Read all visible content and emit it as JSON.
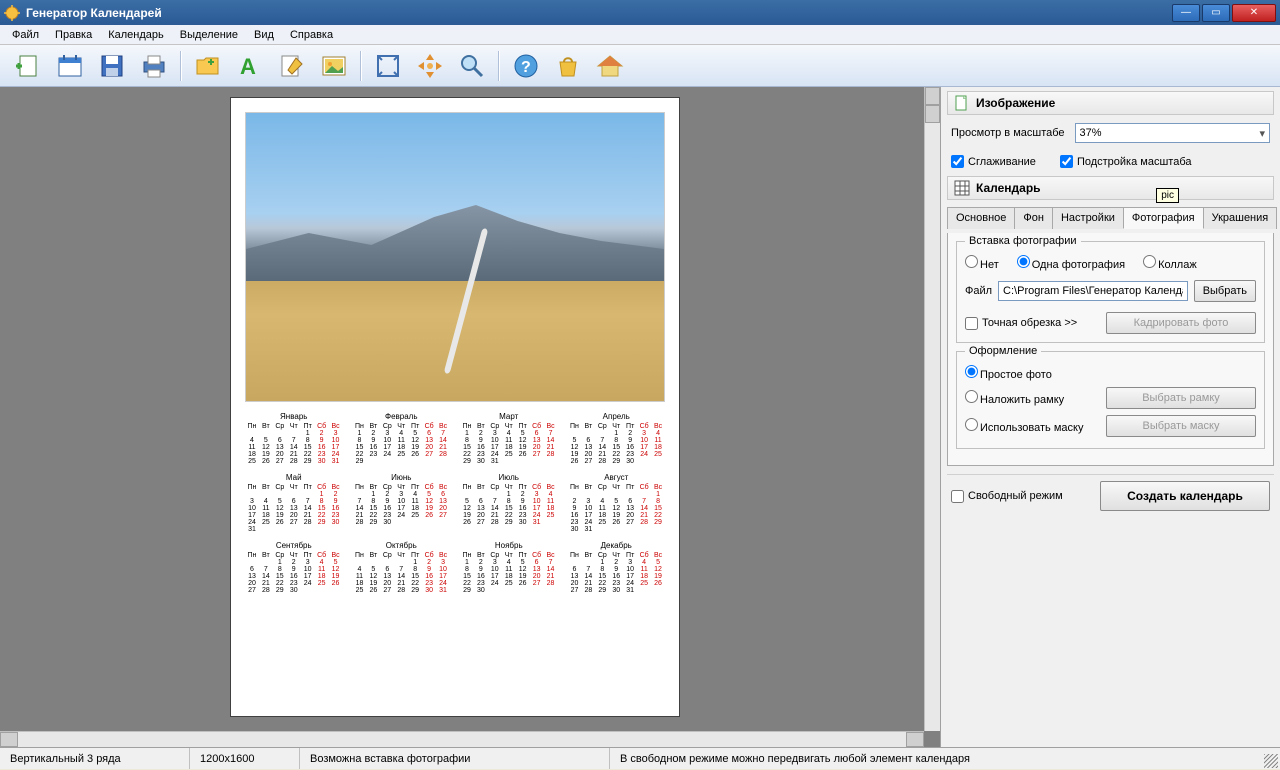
{
  "app": {
    "title": "Генератор Календарей"
  },
  "menu": {
    "file": "Файл",
    "edit": "Правка",
    "calendar": "Календарь",
    "selection": "Выделение",
    "view": "Вид",
    "help": "Справка"
  },
  "tooltip": {
    "pic": "pic"
  },
  "side": {
    "imageSection": "Изображение",
    "zoomLabel": "Просмотр в масштабе",
    "zoomValue": "37%",
    "antialias": "Сглаживание",
    "fitScale": "Подстройка масштаба",
    "calendarSection": "Календарь",
    "tabs": {
      "main": "Основное",
      "bg": "Фон",
      "settings": "Настройки",
      "photo": "Фотография",
      "decor": "Украшения"
    },
    "insertGroup": "Вставка фотографии",
    "radioNone": "Нет",
    "radioOne": "Одна фотография",
    "radioCollage": "Коллаж",
    "fileLabel": "Файл",
    "filePath": "C:\\Program Files\\Генератор Календар",
    "fileBrowse": "Выбрать",
    "exactCrop": "Точная обрезка >>",
    "cropBtn": "Кадрировать фото",
    "styleGroup": "Оформление",
    "styleSimple": "Простое фото",
    "styleFrame": "Наложить рамку",
    "styleFrameBtn": "Выбрать рамку",
    "styleMask": "Использовать маску",
    "styleMaskBtn": "Выбрать маску",
    "freeMode": "Свободный режим",
    "createBtn": "Создать календарь"
  },
  "status": {
    "layout": "Вертикальный 3 ряда",
    "size": "1200x1600",
    "photoHint": "Возможна вставка фотографии",
    "freeHint": "В свободном режиме можно передвигать любой элемент календаря"
  },
  "calendar": {
    "wdays": [
      "Пн",
      "Вт",
      "Ср",
      "Чт",
      "Пт",
      "Сб",
      "Вс"
    ],
    "months": [
      "Январь",
      "Февраль",
      "Март",
      "Апрель",
      "Май",
      "Июнь",
      "Июль",
      "Август",
      "Сентябрь",
      "Октябрь",
      "Ноябрь",
      "Декабрь"
    ],
    "starts": [
      4,
      0,
      0,
      3,
      5,
      1,
      3,
      6,
      2,
      4,
      0,
      2
    ],
    "lens": [
      31,
      29,
      31,
      30,
      31,
      30,
      31,
      31,
      30,
      31,
      30,
      31
    ]
  }
}
